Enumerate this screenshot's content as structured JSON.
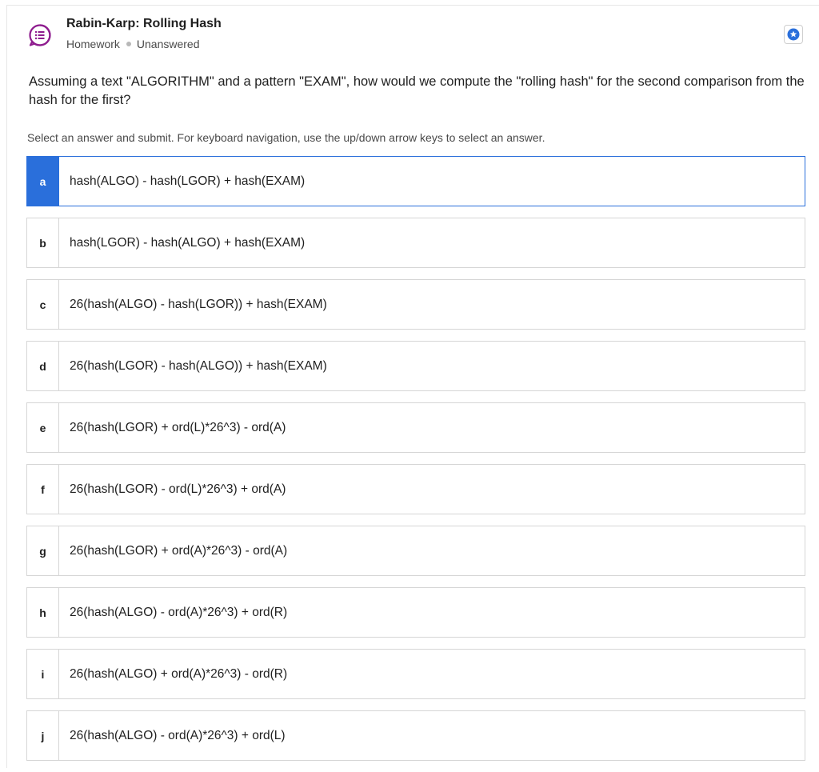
{
  "header": {
    "title": "Rabin-Karp: Rolling Hash",
    "type": "Homework",
    "status": "Unanswered",
    "icon": "question-list-icon",
    "action_icon": "star-icon",
    "accent_color": "#8e1c8e",
    "action_color": "#2a6fdb"
  },
  "question": {
    "text": "Assuming a text \"ALGORITHM\" and a pattern \"EXAM\", how would we compute the \"rolling hash\" for the second comparison from the hash for the first?",
    "instructions": "Select an answer and submit. For keyboard navigation, use the up/down arrow keys to select an answer."
  },
  "options": [
    {
      "letter": "a",
      "text": "hash(ALGO) - hash(LGOR) + hash(EXAM)"
    },
    {
      "letter": "b",
      "text": "hash(LGOR) - hash(ALGO) + hash(EXAM)"
    },
    {
      "letter": "c",
      "text": "26(hash(ALGO) - hash(LGOR)) + hash(EXAM)"
    },
    {
      "letter": "d",
      "text": "26(hash(LGOR) - hash(ALGO)) + hash(EXAM)"
    },
    {
      "letter": "e",
      "text": "26(hash(LGOR) + ord(L)*26^3) - ord(A)"
    },
    {
      "letter": "f",
      "text": "26(hash(LGOR) - ord(L)*26^3) + ord(A)"
    },
    {
      "letter": "g",
      "text": "26(hash(LGOR) + ord(A)*26^3) - ord(A)"
    },
    {
      "letter": "h",
      "text": "26(hash(ALGO) - ord(A)*26^3) + ord(R)"
    },
    {
      "letter": "i",
      "text": "26(hash(ALGO) + ord(A)*26^3) - ord(R)"
    },
    {
      "letter": "j",
      "text": "26(hash(ALGO) - ord(A)*26^3) + ord(L)"
    }
  ],
  "selected_option": "a",
  "selected_color": "#2a6fdb"
}
